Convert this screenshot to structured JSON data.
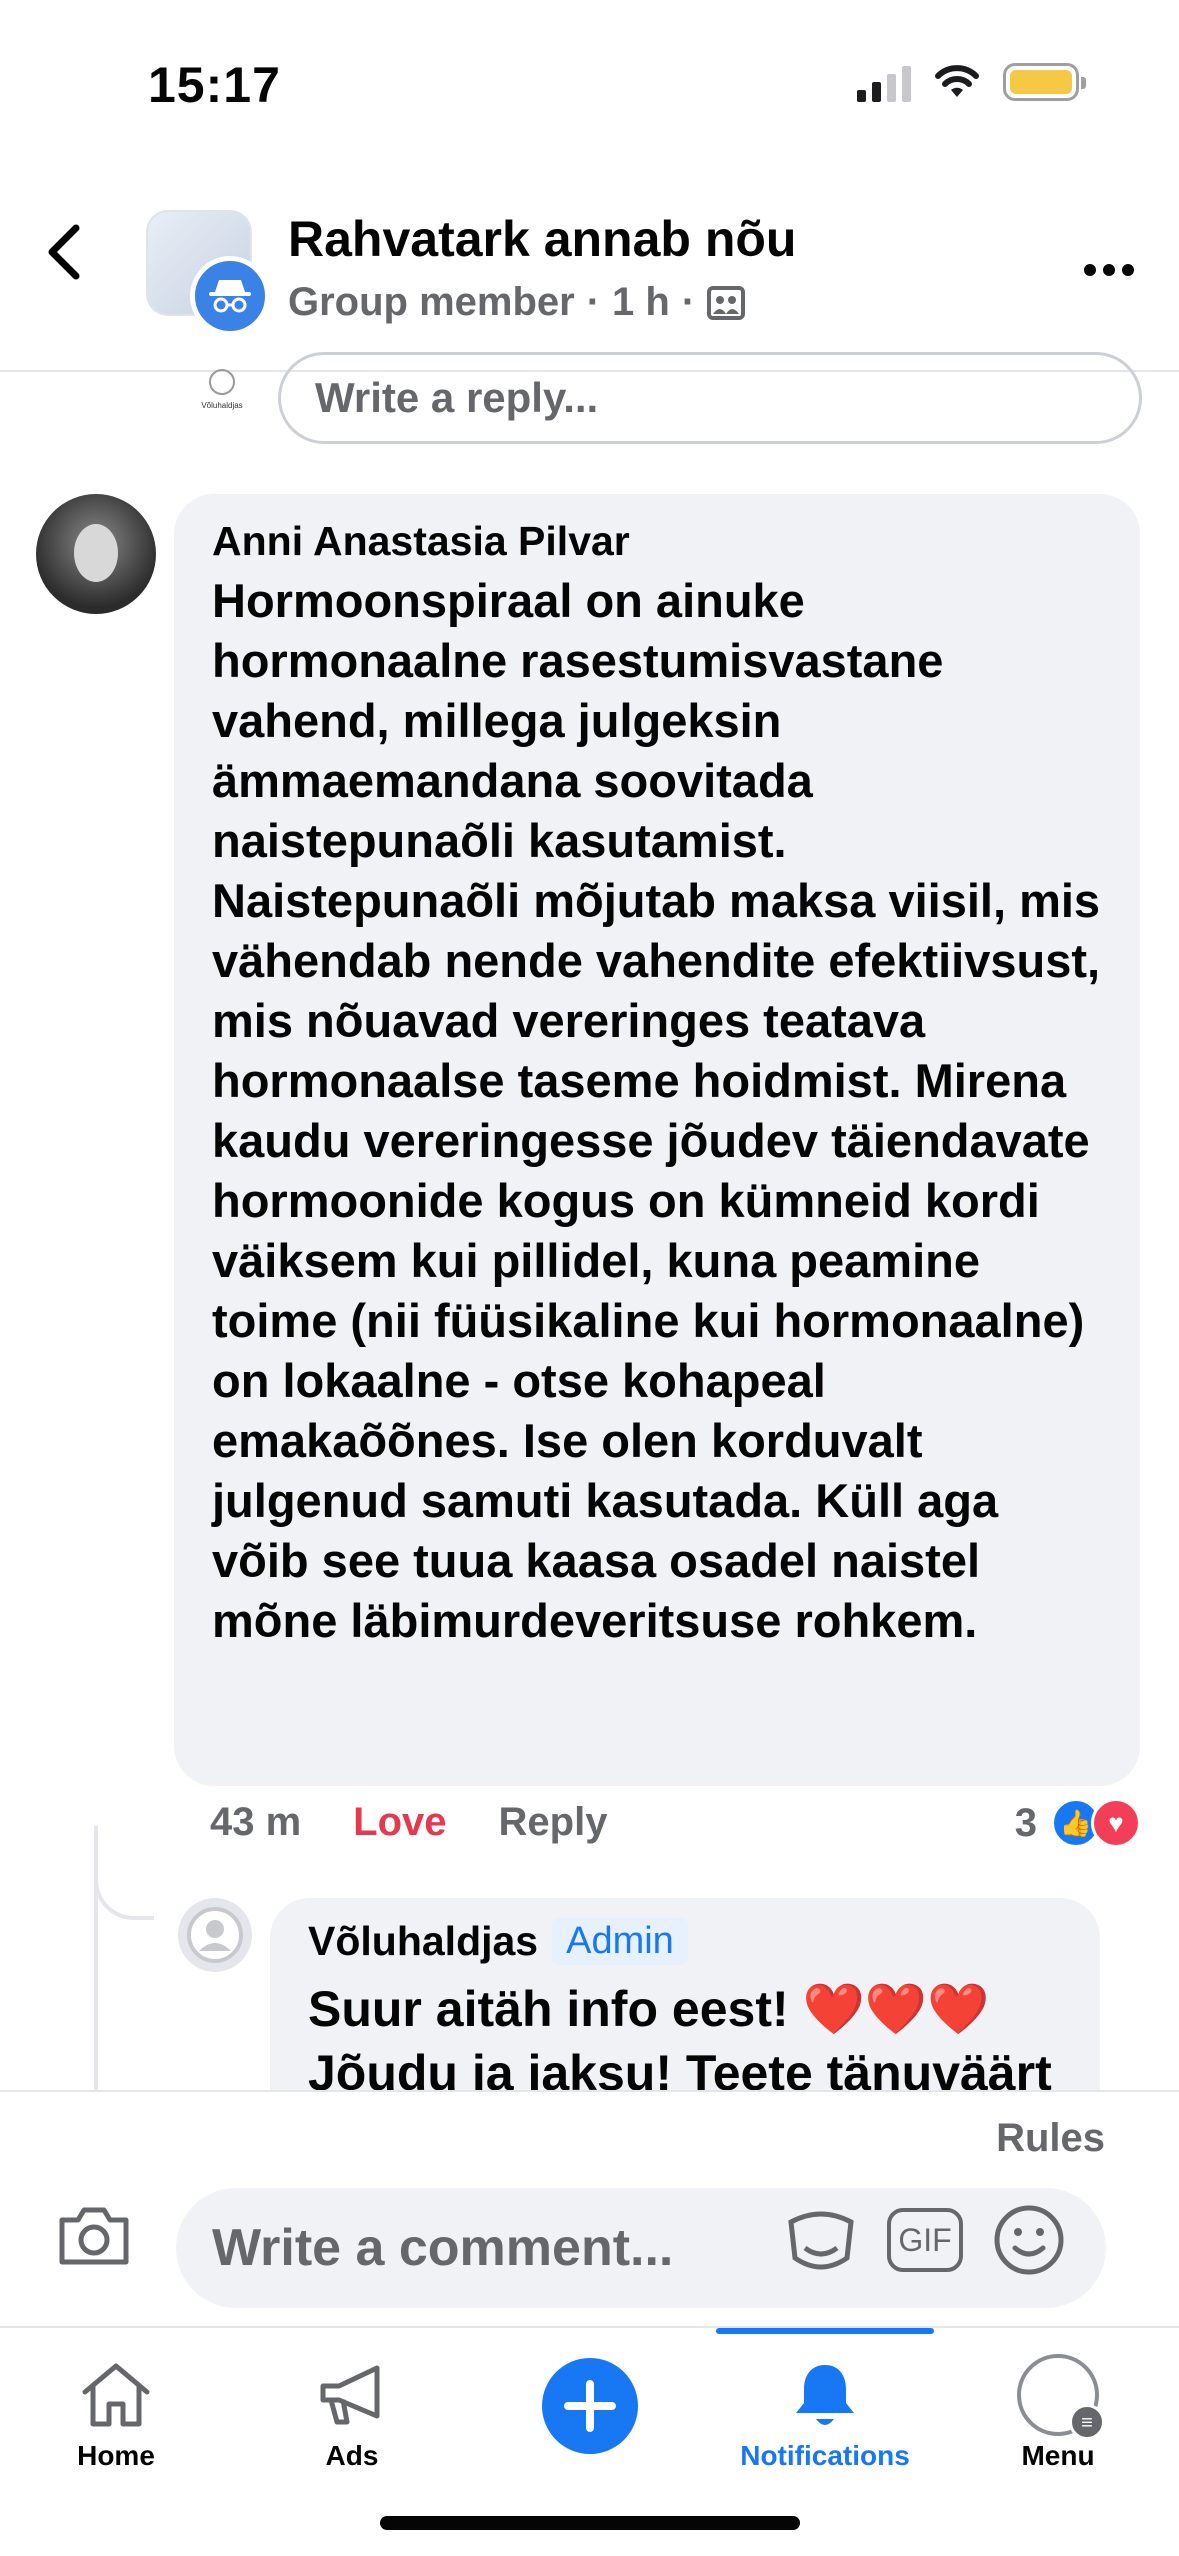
{
  "status_bar": {
    "time": "15:17"
  },
  "header": {
    "title": "Rahvatark annab nõu",
    "role": "Group member",
    "time": "1 h",
    "separator": "·"
  },
  "top_reply": {
    "placeholder": "Write a reply...",
    "avatar_text": "Võluhaldjas"
  },
  "comment": {
    "author": "Anni Anastasia Pilvar",
    "text": "Hormoonspiraal on ainuke hormonaalne rasestumisvastane vahend, millega julgeksin ämmaemandana soovitada naistepunaõli kasutamist. Naistepunaõli mõjutab maksa viisil, mis vähendab nende vahendite efektiivsust, mis nõuavad vereringes teatava hormonaalse taseme hoidmist. Mirena kaudu vereringesse jõudev täiendavate hormoonide kogus on kümneid kordi väiksem kui pillidel, kuna peamine toime (nii füüsikaline kui hormonaalne) on lokaalne - otse kohapeal emakaõõnes. Ise olen korduvalt julgenud samuti kasutada. Küll aga võib see tuua kaasa osadel naistel mõne läbimurdeveritsuse rohkem.",
    "time": "43 m",
    "reaction_label": "Love",
    "reply_label": "Reply",
    "reaction_count": "3"
  },
  "reply": {
    "author": "Võluhaldjas",
    "badge": "Admin",
    "text_line1": "Suur aitäh info eest! ❤️❤️❤️",
    "text_line2": "Jõudu ja jaksu! Teete tänuväärt"
  },
  "composer": {
    "rules_label": "Rules",
    "placeholder": "Write a comment...",
    "gif_label": "GIF"
  },
  "tabs": [
    {
      "label": "Home",
      "icon": "home-icon"
    },
    {
      "label": "Ads",
      "icon": "megaphone-icon"
    },
    {
      "label": "",
      "icon": "plus-icon"
    },
    {
      "label": "Notifications",
      "icon": "bell-icon"
    },
    {
      "label": "Menu",
      "icon": "menu-avatar-icon"
    }
  ],
  "colors": {
    "accent": "#1877f2",
    "love": "#e6394f",
    "secondary_text": "#65676b",
    "bubble": "#f0f2f5",
    "battery": "#f5c945"
  }
}
